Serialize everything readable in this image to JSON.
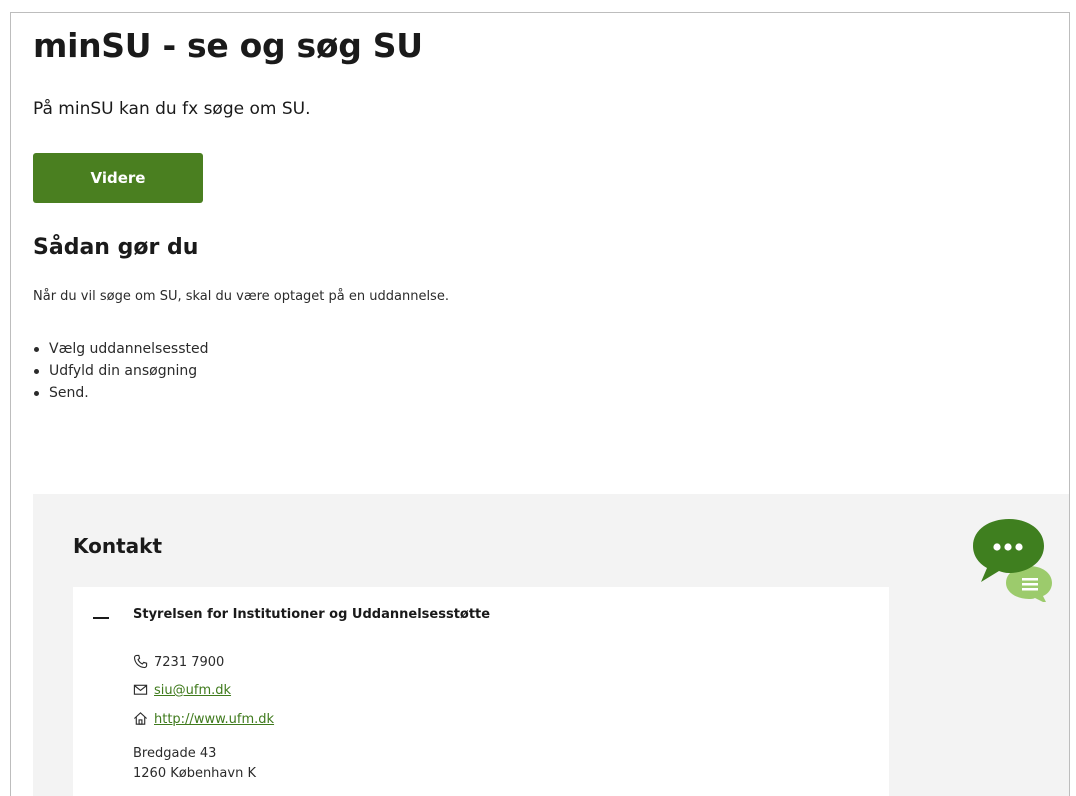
{
  "page": {
    "title": "minSU - se og søg SU",
    "intro": "På minSU kan du fx søge om SU.",
    "cta_label": "Videre"
  },
  "howto": {
    "title": "Sådan gør du",
    "lead": "Når du vil søge om SU, skal du være optaget på en uddannelse.",
    "steps": [
      "Vælg uddannelsessted",
      "Udfyld din ansøgning",
      "Send."
    ]
  },
  "contact": {
    "title": "Kontakt",
    "org_name": "Styrelsen for Institutioner og Uddannelsesstøtte",
    "phone": "7231 7900",
    "email": "siu@ufm.dk",
    "website": "http://www.ufm.dk",
    "address_line1": "Bredgade 43",
    "address_line2": "1260 København K"
  },
  "icons": {
    "accordion": "minus-icon",
    "phone": "phone-icon",
    "email": "envelope-icon",
    "website": "home-icon",
    "chat": "chat-bubble-icon"
  },
  "colors": {
    "accent": "#4a7f20",
    "link": "#3f7a1c",
    "chat_primary": "#3f7f1f",
    "chat_secondary": "#9ccb6c",
    "section_bg": "#f3f3f3"
  }
}
